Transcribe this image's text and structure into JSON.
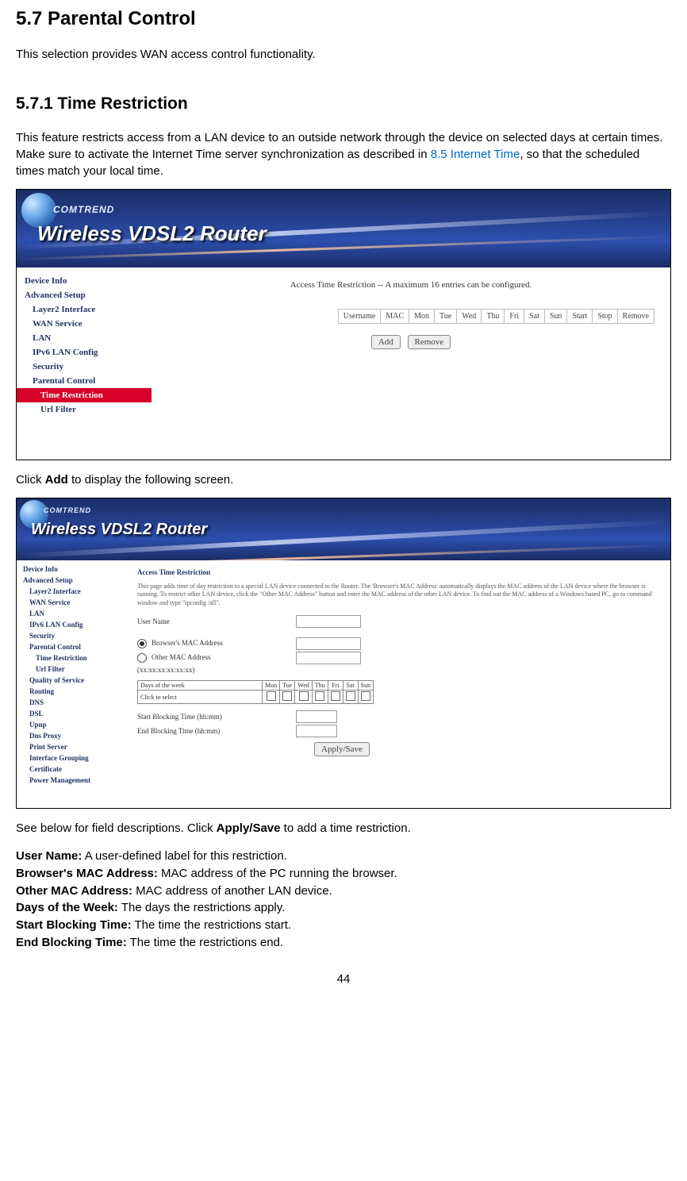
{
  "heading1": "5.7 Parental Control",
  "intro": "This selection provides WAN access control functionality.",
  "heading2": "5.7.1   Time Restriction",
  "para1_a": "This feature restricts access from a LAN device to an outside network through the device on selected days at certain times. Make sure to activate the Internet Time server synchronization as described in ",
  "para1_link": "8.5 Internet Time",
  "para1_b": ", so that the scheduled times match your local time.",
  "ss1": {
    "brand": "COMTREND",
    "product": "Wireless VDSL2 Router",
    "content_title": "Access Time Restriction -- A maximum 16 entries can be configured.",
    "headers": [
      "Username",
      "MAC",
      "Mon",
      "Tue",
      "Wed",
      "Thu",
      "Fri",
      "Sat",
      "Sun",
      "Start",
      "Stop",
      "Remove"
    ],
    "add": "Add",
    "remove": "Remove",
    "nav": [
      "Device Info",
      "Advanced Setup",
      "Layer2 Interface",
      "WAN Service",
      "LAN",
      "IPv6 LAN Config",
      "Security",
      "Parental Control",
      "Time Restriction",
      "Url Filter"
    ]
  },
  "mid_para_a": "Click ",
  "mid_para_b": "Add",
  "mid_para_c": " to display the following screen.",
  "ss2": {
    "brand": "COMTREND",
    "product": "Wireless VDSL2 Router",
    "ctitle": "Access Time Restriction",
    "desc": "This page adds time of day restriction to a special LAN device connected to the Router. The 'Browser's MAC Address' automatically displays the MAC address of the LAN device where the browser is running. To restrict other LAN device, click the \"Other MAC Address\" button and enter the MAC address of the other LAN device. To find out the MAC address of a Windows based PC, go to command window and type \"ipconfig /all\".",
    "user_name": "User Name",
    "browser_mac": "Browser's MAC Address",
    "other_mac": "Other MAC Address",
    "other_mac_fmt": "(xx:xx:xx:xx:xx:xx)",
    "days_label": "Days of the week",
    "click_label": "Click to select",
    "days": [
      "Mon",
      "Tue",
      "Wed",
      "Thu",
      "Fri",
      "Sat",
      "Sun"
    ],
    "start": "Start Blocking Time (hh:mm)",
    "end": "End Blocking Time (hh:mm)",
    "apply": "Apply/Save",
    "nav": [
      "Device Info",
      "Advanced Setup",
      "Layer2 Interface",
      "WAN Service",
      "LAN",
      "IPv6 LAN Config",
      "Security",
      "Parental Control",
      "Time Restriction",
      "Url Filter",
      "Quality of Service",
      "Routing",
      "DNS",
      "DSL",
      "Upnp",
      "Dns Proxy",
      "Print Server",
      "Interface Grouping",
      "Certificate",
      "Power Management"
    ]
  },
  "para2_a": "See below for field descriptions. Click ",
  "para2_b": "Apply/Save",
  "para2_c": " to add a time restriction.",
  "fields": {
    "f1_l": "User Name:",
    "f1_t": " A user-defined label for this restriction.",
    "f2_l": "Browser's MAC Address:",
    "f2_t": " MAC address of the PC running the browser.",
    "f3_l": "Other MAC Address:",
    "f3_t": " MAC address of another LAN device.",
    "f4_l": "Days of the Week:",
    "f4_t": " The days the restrictions apply.",
    "f5_l": "Start Blocking Time:",
    "f5_t": " The time the restrictions start.",
    "f6_l": "End Blocking Time:",
    "f6_t": " The time the restrictions end."
  },
  "page_num": "44"
}
